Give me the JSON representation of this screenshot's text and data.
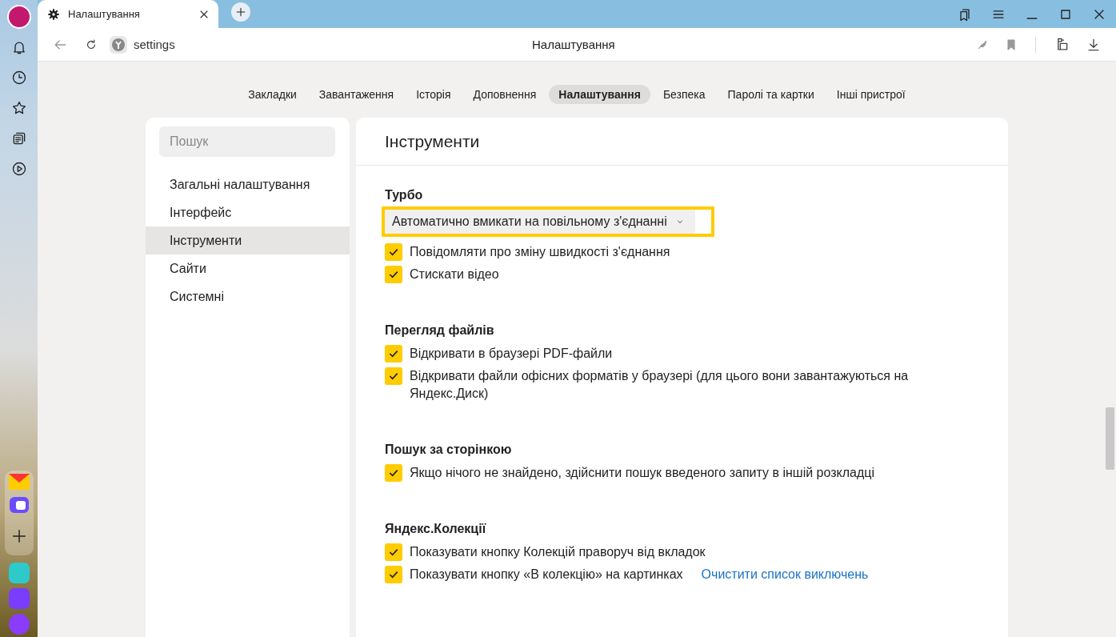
{
  "tab": {
    "title": "Налаштування"
  },
  "address": {
    "url": "settings",
    "page_title": "Налаштування"
  },
  "nav_tabs": [
    {
      "label": "Закладки",
      "selected": false
    },
    {
      "label": "Завантаження",
      "selected": false
    },
    {
      "label": "Історія",
      "selected": false
    },
    {
      "label": "Доповнення",
      "selected": false
    },
    {
      "label": "Налаштування",
      "selected": true
    },
    {
      "label": "Безпека",
      "selected": false
    },
    {
      "label": "Паролі та картки",
      "selected": false
    },
    {
      "label": "Інші пристрої",
      "selected": false
    }
  ],
  "sidebar": {
    "search": {
      "placeholder": "Пошук"
    },
    "items": [
      {
        "label": "Загальні налаштування",
        "selected": false
      },
      {
        "label": "Інтерфейс",
        "selected": false
      },
      {
        "label": "Інструменти",
        "selected": true
      },
      {
        "label": "Сайти",
        "selected": false
      },
      {
        "label": "Системні",
        "selected": false
      }
    ]
  },
  "panel": {
    "title": "Інструменти",
    "sections": [
      {
        "title": "Турбо",
        "items": [
          {
            "kind": "dropdown",
            "label": "Автоматично вмикати на повільному з'єднанні",
            "highlighted": true
          },
          {
            "kind": "checkbox",
            "label": "Повідомляти про зміну швидкості з'єднання",
            "checked": true
          },
          {
            "kind": "checkbox",
            "label": "Стискати відео",
            "checked": true
          }
        ]
      },
      {
        "title": "Перегляд файлів",
        "items": [
          {
            "kind": "checkbox",
            "label": "Відкривати в браузері PDF-файли",
            "checked": true
          },
          {
            "kind": "checkbox",
            "label": "Відкривати файли офісних форматів у браузері (для цього вони завантажуються на Яндекс.Диск)",
            "checked": true
          }
        ]
      },
      {
        "title": "Пошук за сторінкою",
        "items": [
          {
            "kind": "checkbox",
            "label": "Якщо нічого не знайдено, здійснити пошук введеного запиту в іншій розкладці",
            "checked": true
          }
        ]
      },
      {
        "title": "Яндекс.Колекції",
        "items": [
          {
            "kind": "checkbox",
            "label": "Показувати кнопку Колекцій праворуч від вкладок",
            "checked": true
          },
          {
            "kind": "checkbox",
            "label": "Показувати кнопку «В колекцію» на картинках",
            "checked": true,
            "link": "Очистити список виключень"
          }
        ]
      }
    ]
  }
}
